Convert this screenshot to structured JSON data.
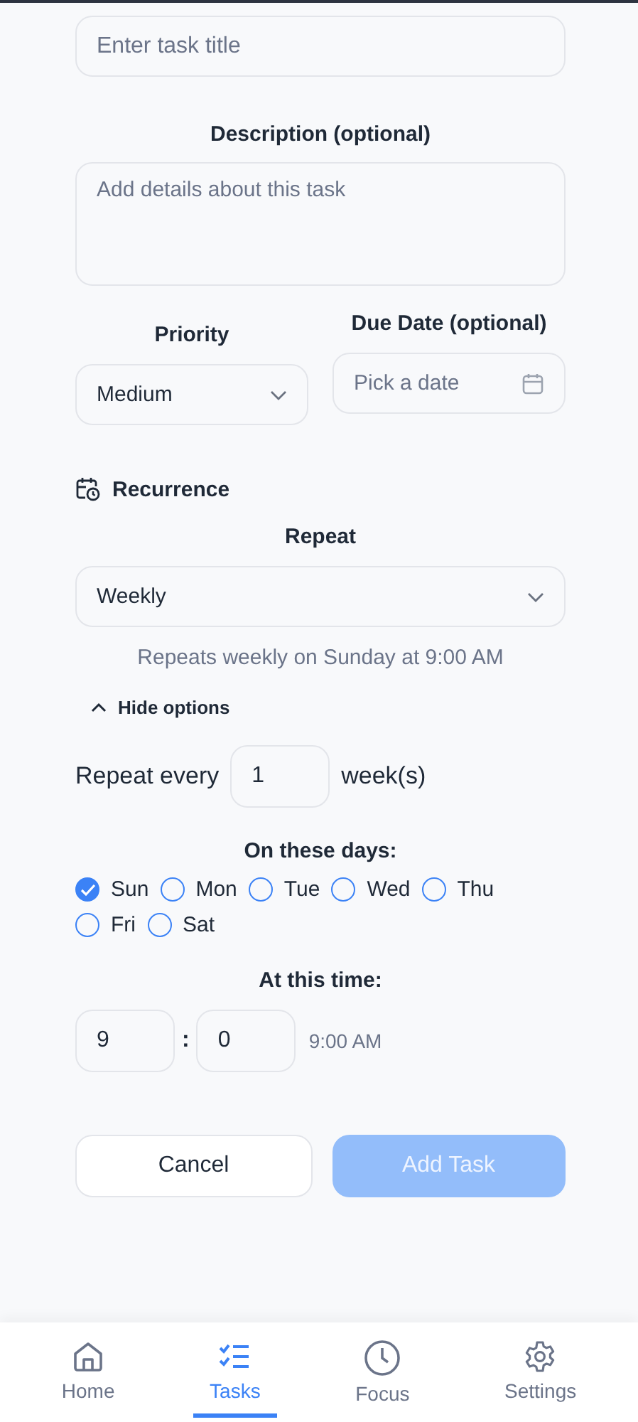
{
  "title_field": {
    "placeholder": "Enter task title"
  },
  "description": {
    "label": "Description (optional)",
    "placeholder": "Add details about this task"
  },
  "priority": {
    "label": "Priority",
    "value": "Medium"
  },
  "due_date": {
    "label": "Due Date (optional)",
    "placeholder": "Pick a date"
  },
  "recurrence": {
    "heading": "Recurrence",
    "repeat_label": "Repeat",
    "repeat_value": "Weekly",
    "summary": "Repeats weekly on Sunday at 9:00 AM",
    "toggle": "Hide options",
    "expanded": true,
    "interval_prefix": "Repeat every",
    "interval_value": "1",
    "interval_unit": "week(s)",
    "days_label": "On these days:",
    "days": [
      {
        "label": "Sun",
        "checked": true
      },
      {
        "label": "Mon",
        "checked": false
      },
      {
        "label": "Tue",
        "checked": false
      },
      {
        "label": "Wed",
        "checked": false
      },
      {
        "label": "Thu",
        "checked": false
      },
      {
        "label": "Fri",
        "checked": false
      },
      {
        "label": "Sat",
        "checked": false
      }
    ],
    "time_label": "At this time:",
    "hour": "9",
    "separator": ":",
    "minute": "0",
    "time_preview": "9:00 AM"
  },
  "buttons": {
    "cancel": "Cancel",
    "submit": "Add Task",
    "submit_disabled": true
  },
  "nav": [
    {
      "label": "Home",
      "kind": "home",
      "selected": false
    },
    {
      "label": "Tasks",
      "kind": "tasks",
      "selected": true
    },
    {
      "label": "Focus",
      "kind": "clock",
      "selected": false
    },
    {
      "label": "Settings",
      "kind": "gear",
      "selected": false
    }
  ]
}
